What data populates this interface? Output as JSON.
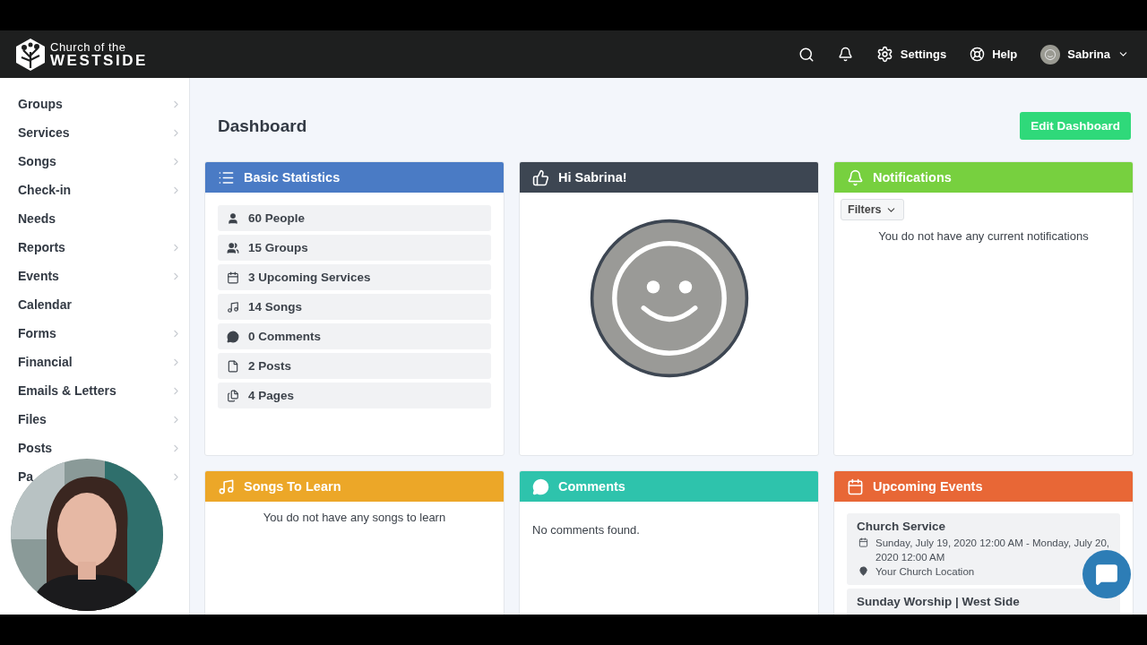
{
  "header": {
    "logo_line1": "Church of the",
    "logo_line2": "WESTSIDE",
    "nav": [
      {
        "kind": "search"
      },
      {
        "kind": "bell"
      },
      {
        "kind": "settings",
        "label": "Settings"
      },
      {
        "kind": "help",
        "label": "Help"
      }
    ],
    "user": {
      "name": "Sabrina"
    }
  },
  "sidebar": {
    "items": [
      {
        "label": "Groups",
        "has_children": true
      },
      {
        "label": "Services",
        "has_children": true
      },
      {
        "label": "Songs",
        "has_children": true
      },
      {
        "label": "Check-in",
        "has_children": true
      },
      {
        "label": "Needs",
        "has_children": false
      },
      {
        "label": "Reports",
        "has_children": true
      },
      {
        "label": "Events",
        "has_children": true
      },
      {
        "label": "Calendar",
        "has_children": false
      },
      {
        "label": "Forms",
        "has_children": true
      },
      {
        "label": "Financial",
        "has_children": true
      },
      {
        "label": "Emails & Letters",
        "has_children": true
      },
      {
        "label": "Files",
        "has_children": true
      },
      {
        "label": "Posts",
        "has_children": true
      },
      {
        "label": "Pa",
        "has_children": true
      }
    ]
  },
  "page": {
    "title": "Dashboard",
    "action": "Edit Dashboard"
  },
  "cards": [
    {
      "kind": "stats",
      "title": "Basic Statistics",
      "color": "#4a7bc5",
      "stats": [
        {
          "kind": "person",
          "label": "60 People"
        },
        {
          "kind": "group",
          "label": "15 Groups"
        },
        {
          "kind": "calendar",
          "label": "3 Upcoming Services"
        },
        {
          "kind": "music",
          "label": "14 Songs"
        },
        {
          "kind": "comments",
          "label": "0 Comments"
        },
        {
          "kind": "post",
          "label": "2 Posts"
        },
        {
          "kind": "pages",
          "label": "4 Pages"
        }
      ]
    },
    {
      "kind": "greeting",
      "title": "Hi Sabrina!",
      "color": "#3d4652"
    },
    {
      "kind": "notifications",
      "title": "Notifications",
      "color": "#77d03f",
      "filter": "Filters",
      "message": "You do not have any current notifications"
    },
    {
      "kind": "songs",
      "title": "Songs To Learn",
      "color": "#eca728",
      "message": "You do not have any songs to learn"
    },
    {
      "kind": "comments",
      "title": "Comments",
      "color": "#2ec3ac",
      "message": "No comments found."
    },
    {
      "kind": "events",
      "title": "Upcoming Events",
      "color": "#e86736",
      "events": [
        {
          "name": "Church Service",
          "when": "Sunday, July 19, 2020 12:00 AM - Monday, July 20, 2020 12:00 AM",
          "where": "Your Church Location"
        },
        {
          "name": "Sunday Worship | West Side"
        }
      ]
    }
  ]
}
